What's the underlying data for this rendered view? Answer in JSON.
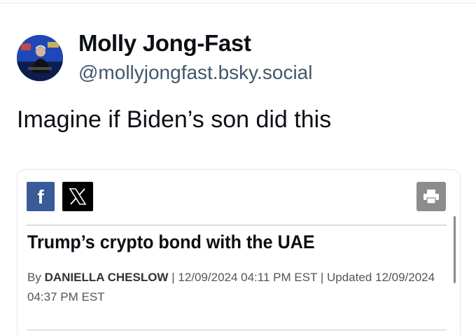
{
  "author": {
    "name": "Molly Jong-Fast",
    "handle": "@mollyjongfast.bsky.social"
  },
  "post": {
    "text": "Imagine if Biden’s son did this"
  },
  "embed": {
    "share_buttons": [
      {
        "icon": "facebook-icon",
        "label": "f"
      },
      {
        "icon": "x-logo-icon"
      }
    ],
    "print_icon": "print-icon",
    "headline": "Trump’s crypto bond with the UAE",
    "byline": {
      "prefix": "By ",
      "author": "DANIELLA CHESLOW",
      "published": " | 12/09/2024 04:11 PM EST | Updated 12/09/2024 04:37 PM EST"
    }
  },
  "colors": {
    "facebook_blue": "#3b5b98",
    "handle_gray": "#42576c",
    "print_gray": "#8c8c8c"
  }
}
